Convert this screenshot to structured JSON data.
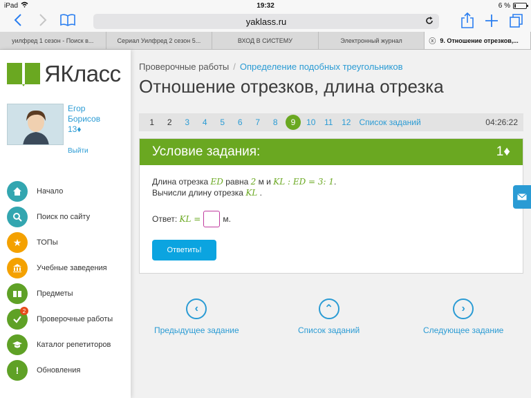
{
  "status": {
    "device": "iPad",
    "time": "19:32",
    "battery": "6 %"
  },
  "browser": {
    "url": "yaklass.ru",
    "tabs": [
      {
        "label": "уилфред 1 сезон - Поиск в..."
      },
      {
        "label": "Сериал Уилфред 2 сезон 5..."
      },
      {
        "label": "ВХОД В СИСТЕМУ"
      },
      {
        "label": "Электронный журнал"
      },
      {
        "label": "9. Отношение отрезков,..."
      }
    ]
  },
  "sidebar": {
    "logo_text": "ЯКласс",
    "user": {
      "first_name": "Егор",
      "last_name": "Борисов",
      "points": "13♦",
      "logout": "Выйти"
    },
    "menu": [
      {
        "label": "Начало",
        "icon": "home-icon",
        "color": "teal"
      },
      {
        "label": "Поиск по сайту",
        "icon": "search-icon",
        "color": "teal"
      },
      {
        "label": "ТОПы",
        "icon": "star-icon",
        "color": "orange"
      },
      {
        "label": "Учебные заведения",
        "icon": "building-icon",
        "color": "orange"
      },
      {
        "label": "Предметы",
        "icon": "books-icon",
        "color": "green"
      },
      {
        "label": "Проверочные работы",
        "icon": "check-icon",
        "color": "green",
        "badge": "2"
      },
      {
        "label": "Каталог репетиторов",
        "icon": "graduation-cap-icon",
        "color": "green"
      },
      {
        "label": "Обновления",
        "icon": "exclamation-icon",
        "color": "green"
      }
    ]
  },
  "main": {
    "breadcrumb": {
      "root": "Проверочные работы",
      "link": "Определение подобных треугольников"
    },
    "title": "Отношение отрезков, длина отрезка",
    "task_nav": {
      "numbers": [
        "1",
        "2",
        "3",
        "4",
        "5",
        "6",
        "7",
        "8",
        "9",
        "10",
        "11",
        "12"
      ],
      "current": "9",
      "list_label": "Список заданий",
      "timer": "04:26:22"
    },
    "task": {
      "header": "Условие задания:",
      "points": "1♦",
      "line1_prefix": "Длина отрезка",
      "seg1": "ED",
      "line1_mid": "равна",
      "value": "2",
      "line1_unit": "м и",
      "ratio": "KL : ED = 3: 1",
      "line1_end": ".",
      "line2": "Вычисли длину отрезка",
      "seg2": "KL",
      "line2_end": ".",
      "answer_label": "Ответ:",
      "answer_expr": "KL =",
      "answer_unit": "м.",
      "submit": "Ответить!"
    },
    "bottom_nav": {
      "prev": "Предыдущее задание",
      "list": "Список заданий",
      "next": "Следующее задание"
    }
  },
  "colors": {
    "accent_green": "#6aa821",
    "link_blue": "#2a9bd4",
    "button_blue": "#0ba4e0"
  }
}
